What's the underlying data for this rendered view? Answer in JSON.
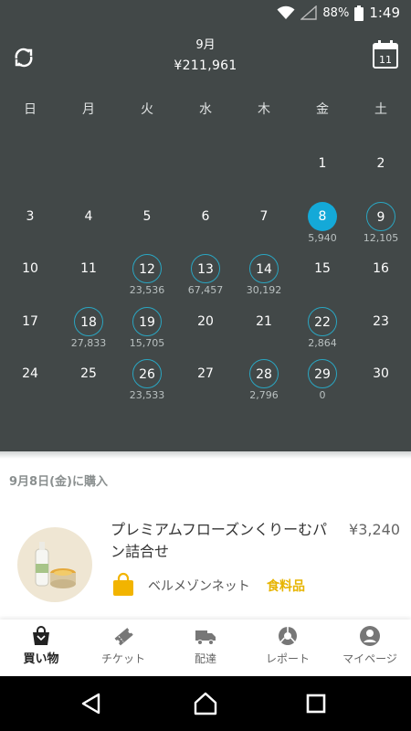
{
  "status_bar": {
    "battery": "88%",
    "time": "1:49"
  },
  "header": {
    "month": "9月",
    "total": "¥211,961",
    "calendar_icon_day": "11"
  },
  "weekdays": [
    "日",
    "月",
    "火",
    "水",
    "木",
    "金",
    "土"
  ],
  "calendar_days": [
    {
      "day": "1",
      "amount": "",
      "state": "none"
    },
    {
      "day": "2",
      "amount": "",
      "state": "none"
    },
    {
      "day": "3",
      "amount": "",
      "state": "none"
    },
    {
      "day": "4",
      "amount": "",
      "state": "none"
    },
    {
      "day": "5",
      "amount": "",
      "state": "none"
    },
    {
      "day": "6",
      "amount": "",
      "state": "none"
    },
    {
      "day": "7",
      "amount": "",
      "state": "none"
    },
    {
      "day": "8",
      "amount": "5,940",
      "state": "selected"
    },
    {
      "day": "9",
      "amount": "12,105",
      "state": "purchase"
    },
    {
      "day": "10",
      "amount": "",
      "state": "none"
    },
    {
      "day": "11",
      "amount": "",
      "state": "none"
    },
    {
      "day": "12",
      "amount": "23,536",
      "state": "purchase"
    },
    {
      "day": "13",
      "amount": "67,457",
      "state": "purchase"
    },
    {
      "day": "14",
      "amount": "30,192",
      "state": "purchase"
    },
    {
      "day": "15",
      "amount": "",
      "state": "none"
    },
    {
      "day": "16",
      "amount": "",
      "state": "none"
    },
    {
      "day": "17",
      "amount": "",
      "state": "none"
    },
    {
      "day": "18",
      "amount": "27,833",
      "state": "purchase"
    },
    {
      "day": "19",
      "amount": "15,705",
      "state": "purchase"
    },
    {
      "day": "20",
      "amount": "",
      "state": "none"
    },
    {
      "day": "21",
      "amount": "",
      "state": "none"
    },
    {
      "day": "22",
      "amount": "2,864",
      "state": "purchase"
    },
    {
      "day": "23",
      "amount": "",
      "state": "none"
    },
    {
      "day": "24",
      "amount": "",
      "state": "none"
    },
    {
      "day": "25",
      "amount": "",
      "state": "none"
    },
    {
      "day": "26",
      "amount": "23,533",
      "state": "purchase"
    },
    {
      "day": "27",
      "amount": "",
      "state": "none"
    },
    {
      "day": "28",
      "amount": "2,796",
      "state": "purchase"
    },
    {
      "day": "29",
      "amount": "0",
      "state": "purchase"
    },
    {
      "day": "30",
      "amount": "",
      "state": "none"
    }
  ],
  "purchase_list": {
    "date_heading": "9月8日(金)に購入",
    "items": [
      {
        "title": "プレミアムフローズンくりーむパン詰合せ",
        "price": "¥3,240",
        "shop": "ベルメゾンネット",
        "category": "食料品"
      }
    ]
  },
  "bottom_nav": [
    {
      "label": "買い物",
      "icon": "shopping-bag-icon",
      "active": true
    },
    {
      "label": "チケット",
      "icon": "ticket-icon",
      "active": false
    },
    {
      "label": "配達",
      "icon": "truck-icon",
      "active": false
    },
    {
      "label": "レポート",
      "icon": "pie-chart-icon",
      "active": false
    },
    {
      "label": "マイページ",
      "icon": "account-icon",
      "active": false
    }
  ],
  "colors": {
    "header_bg": "#424848",
    "selected": "#14a9d8",
    "ring": "#2aa6c2",
    "category": "#e7b400"
  }
}
